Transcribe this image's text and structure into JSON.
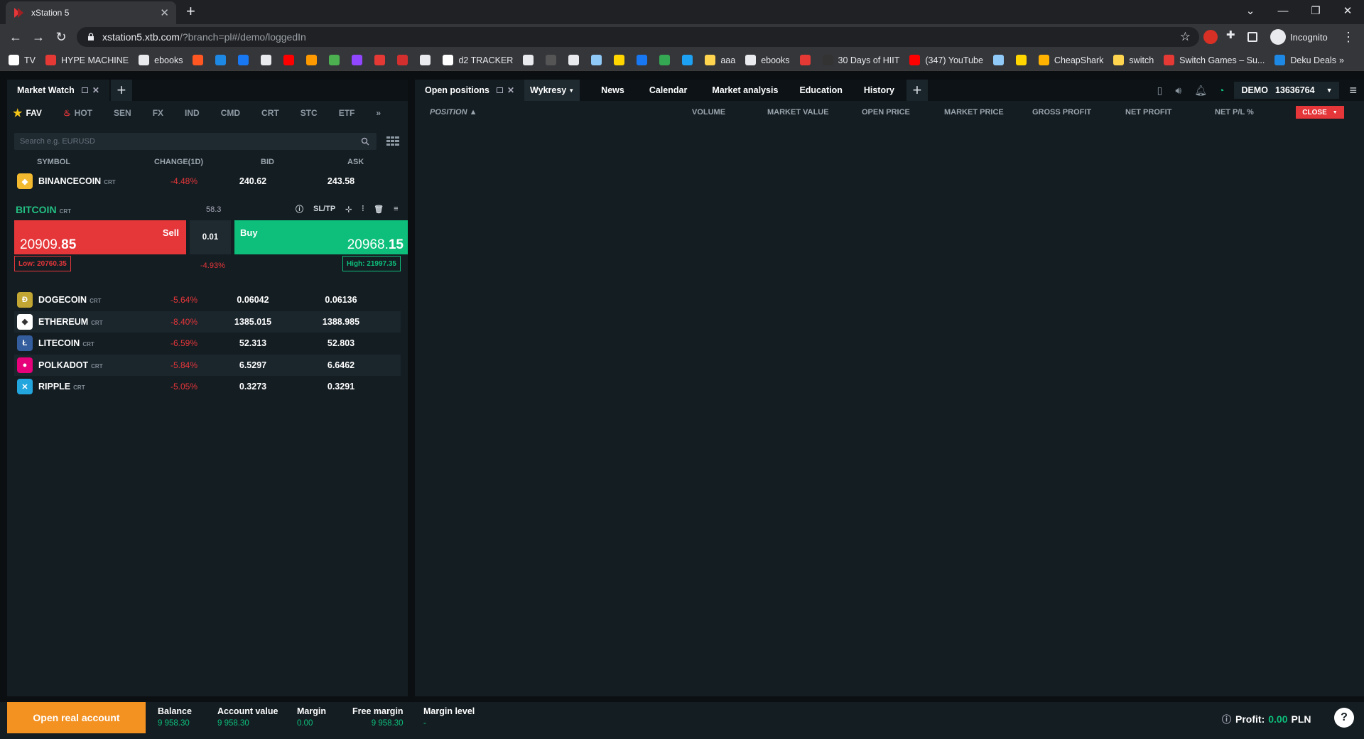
{
  "browser": {
    "tab_title": "xStation 5",
    "url_host": "xstation5.xtb.com",
    "url_path": "/?branch=pl#/demo/loggedIn",
    "incognito_label": "Incognito",
    "bookmarks": [
      {
        "label": "TV",
        "color": "#ffffff"
      },
      {
        "label": "HYPE MACHINE",
        "color": "#e53935"
      },
      {
        "label": "ebooks",
        "color": "#e8eaed"
      },
      {
        "label": "",
        "color": "#ff5722"
      },
      {
        "label": "",
        "color": "#1e88e5"
      },
      {
        "label": "",
        "color": "#1877f2"
      },
      {
        "label": "",
        "color": "#e8eaed"
      },
      {
        "label": "",
        "color": "#ff0000"
      },
      {
        "label": "",
        "color": "#ff9900"
      },
      {
        "label": "",
        "color": "#4caf50"
      },
      {
        "label": "",
        "color": "#9146ff"
      },
      {
        "label": "",
        "color": "#e53935"
      },
      {
        "label": "",
        "color": "#d32f2f"
      },
      {
        "label": "",
        "color": "#e8eaed"
      },
      {
        "label": "d2 TRACKER",
        "color": "#ffffff"
      },
      {
        "label": "",
        "color": "#e8eaed"
      },
      {
        "label": "",
        "color": "#555555"
      },
      {
        "label": "",
        "color": "#e8eaed"
      },
      {
        "label": "",
        "color": "#90caf9"
      },
      {
        "label": "",
        "color": "#ffd600"
      },
      {
        "label": "",
        "color": "#1877f2"
      },
      {
        "label": "",
        "color": "#34a853"
      },
      {
        "label": "",
        "color": "#1da1f2"
      },
      {
        "label": "aaa",
        "color": "#ffd54f"
      },
      {
        "label": "ebooks",
        "color": "#e8eaed"
      },
      {
        "label": "",
        "color": "#e53935"
      },
      {
        "label": "30 Days of HIIT",
        "color": "#333333"
      },
      {
        "label": "(347) YouTube",
        "color": "#ff0000"
      },
      {
        "label": "",
        "color": "#90caf9"
      },
      {
        "label": "",
        "color": "#ffd600"
      },
      {
        "label": "CheapShark",
        "color": "#ffb300"
      },
      {
        "label": "switch",
        "color": "#ffd54f"
      },
      {
        "label": "Switch Games – Su...",
        "color": "#e53935"
      },
      {
        "label": "Deku Deals",
        "color": "#1e88e5"
      }
    ]
  },
  "market_watch": {
    "tab_title": "Market Watch",
    "categories": [
      "FAV",
      "HOT",
      "SEN",
      "FX",
      "IND",
      "CMD",
      "CRT",
      "STC",
      "ETF"
    ],
    "search_placeholder": "Search e.g. EURUSD",
    "columns": {
      "symbol": "SYMBOL",
      "change": "CHANGE(1D)",
      "bid": "BID",
      "ask": "ASK"
    },
    "top_row": {
      "symbol": "BINANCECOIN",
      "tag": "CRT",
      "change": "-4.48%",
      "bid": "240.62",
      "ask": "243.58",
      "icon": "binance-icon",
      "color": "#f3ba2f"
    },
    "bitcoin": {
      "name": "BITCOIN",
      "tag": "CRT",
      "spread": "58.3",
      "sltp": "SL/TP",
      "sell_label": "Sell",
      "sell_main": "20909.",
      "sell_big": "85",
      "buy_label": "Buy",
      "buy_main": "20968.",
      "buy_big": "15",
      "volume": "0.01",
      "low": "Low: 20760.35",
      "high": "High: 21997.35",
      "change": "-4.93%"
    },
    "rows": [
      {
        "symbol": "DOGECOIN",
        "tag": "CRT",
        "change": "-5.64%",
        "bid": "0.06042",
        "ask": "0.06136",
        "color": "#c2a633",
        "glyph": "Ð"
      },
      {
        "symbol": "ETHEREUM",
        "tag": "CRT",
        "change": "-8.40%",
        "bid": "1385.015",
        "ask": "1388.985",
        "color": "#ffffff",
        "glyph": "◆"
      },
      {
        "symbol": "LITECOIN",
        "tag": "CRT",
        "change": "-6.59%",
        "bid": "52.313",
        "ask": "52.803",
        "color": "#345d9d",
        "glyph": "Ł"
      },
      {
        "symbol": "POLKADOT",
        "tag": "CRT",
        "change": "-5.84%",
        "bid": "6.5297",
        "ask": "6.6462",
        "color": "#e6007a",
        "glyph": "●"
      },
      {
        "symbol": "RIPPLE",
        "tag": "CRT",
        "change": "-5.05%",
        "bid": "0.3273",
        "ask": "0.3291",
        "color": "#23a6de",
        "glyph": "✕"
      }
    ]
  },
  "workspace": {
    "tabs": [
      "Open positions",
      "Wykresy",
      "News",
      "Calendar",
      "Market analysis",
      "Education",
      "History"
    ],
    "account_label": "DEMO",
    "account_number": "13636764",
    "columns": [
      "POSITION ▲",
      "VOLUME",
      "MARKET VALUE",
      "OPEN PRICE",
      "MARKET PRICE",
      "GROSS PROFIT",
      "NET PROFIT",
      "NET P/L %"
    ],
    "close_label": "CLOSE"
  },
  "footer": {
    "cta": "Open real account",
    "stats": [
      {
        "label": "Balance",
        "value": "9 958.30"
      },
      {
        "label": "Account value",
        "value": "9 958.30"
      },
      {
        "label": "Margin",
        "value": "0.00"
      },
      {
        "label": "Free margin",
        "value": "9 958.30"
      },
      {
        "label": "Margin level",
        "value": "-"
      }
    ],
    "profit_label": "Profit:",
    "profit_value": "0.00",
    "profit_currency": "PLN",
    "help": "?"
  },
  "colors": {
    "sell": "#e5363a",
    "buy": "#0dbf7b",
    "accent": "#f39121"
  }
}
